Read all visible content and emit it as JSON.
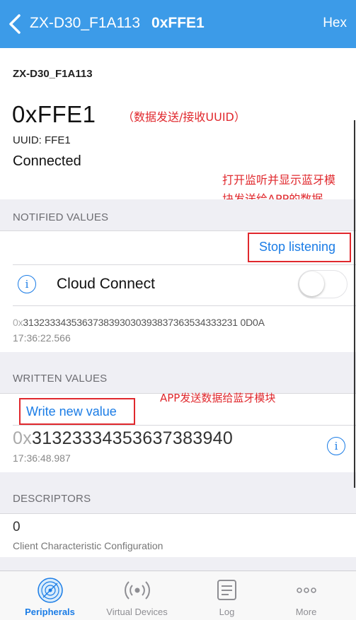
{
  "navbar": {
    "back_title": "ZX-D30_F1A113",
    "uuid": "0xFFE1",
    "hex_button": "Hex"
  },
  "device": {
    "name": "ZX-D30_F1A113",
    "characteristic": "0xFFE1",
    "characteristic_annotation": "（数据发送/接收UUID）",
    "uuid_line": "UUID: FFE1",
    "status": "Connected",
    "notify_annotation_line1": "打开监听并显示蓝牙模",
    "notify_annotation_line2": "块发送给APP的数据"
  },
  "notified": {
    "header": "NOTIFIED VALUES",
    "stop_button": "Stop listening",
    "cloud_label": "Cloud Connect",
    "cloud_enabled": false,
    "value_prefix": "0x",
    "value": "313233343536373839303039383736353433323 10D0A",
    "value_full": "3132333435363738393030393837363534333231 0D0A",
    "time": "17:36:22.566"
  },
  "written": {
    "header": "WRITTEN VALUES",
    "annotation": "APP发送数据给蓝牙模块",
    "write_button": "Write new value",
    "value_prefix": "0x",
    "value": "31323334353637383940",
    "time": "17:36:48.987"
  },
  "descriptors": {
    "header": "DESCRIPTORS",
    "value": "0",
    "name": "Client Characteristic Configuration"
  },
  "tabs": [
    {
      "label": "Peripherals",
      "icon": "peripherals-icon",
      "active": true
    },
    {
      "label": "Virtual Devices",
      "icon": "virtual-devices-icon",
      "active": false
    },
    {
      "label": "Log",
      "icon": "log-icon",
      "active": false
    },
    {
      "label": "More",
      "icon": "more-icon",
      "active": false
    }
  ],
  "colors": {
    "navbar": "#3c9be8",
    "accent": "#1a7ce6",
    "annotation": "#e0282d"
  }
}
